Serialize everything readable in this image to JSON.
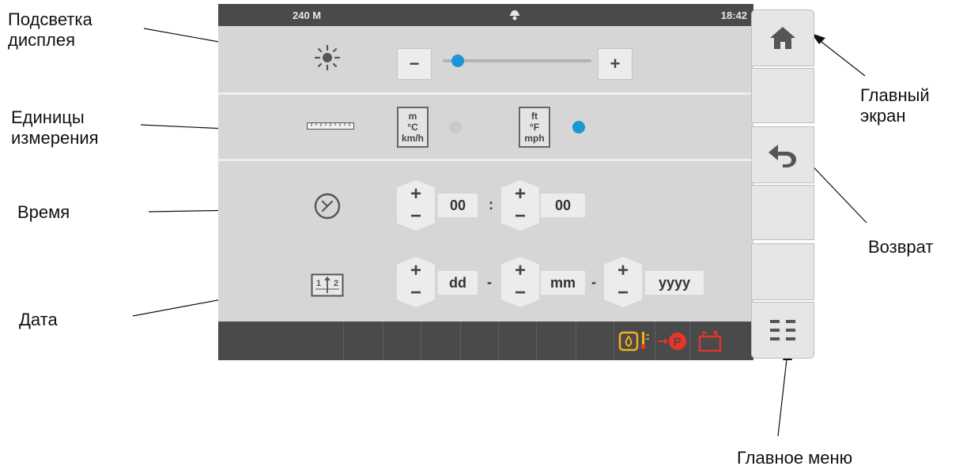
{
  "callouts": {
    "backlight": "Подсветка\nдисплея",
    "units": "Единицы\nизмерения",
    "time": "Время",
    "date": "Дата",
    "home": "Главный\nэкран",
    "back": "Возврат",
    "main_menu": "Главное меню"
  },
  "status_bar": {
    "left": "240 M",
    "center_icon": "operator-helmet-icon",
    "clock": "18:42"
  },
  "backlight": {
    "icon": "brightness-sun-icon",
    "decrease_label": "−",
    "increase_label": "+",
    "level_fraction": 0.1
  },
  "units": {
    "icon": "ruler-icon",
    "metric": {
      "line1": "m",
      "line2": "°C",
      "line3": "km/h",
      "selected": false
    },
    "imperial": {
      "line1": "ft",
      "line2": "°F",
      "line3": "mph",
      "selected": true
    },
    "radio_on_color": "#1c95d4",
    "radio_off_color": "#c9c9c9"
  },
  "time": {
    "icon": "clock-icon",
    "hours": "00",
    "minutes": "00",
    "separator": ":",
    "plus": "+",
    "minus": "−"
  },
  "date": {
    "icon": "calendar-icon",
    "day": "dd",
    "month": "mm",
    "year": "yyyy",
    "separator": "-",
    "plus": "+",
    "minus": "−"
  },
  "warning_icons": [
    "oil-temperature-warning-icon",
    "parking-brake-icon",
    "battery-icon"
  ],
  "warning_colors": {
    "yellow": "#f3b21b",
    "red": "#e8342a"
  },
  "side_buttons": [
    "home-icon",
    "",
    "back-arrow-icon",
    "",
    "",
    "main-menu-icon"
  ]
}
